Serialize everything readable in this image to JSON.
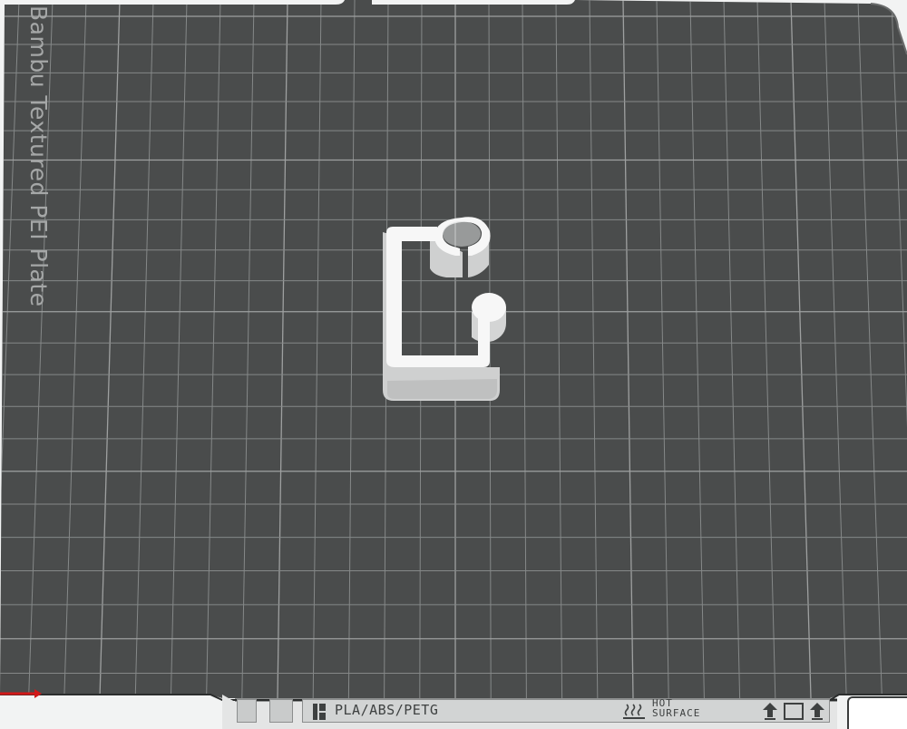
{
  "plate": {
    "name": "Bambu Textured PEI Plate",
    "material_label": "PLA/ABS/PETG",
    "hot_surface_label": "HOT\nSURFACE"
  },
  "colors": {
    "plate_surface": "#4a4c4c",
    "grid_line": "#8a8d8d",
    "grid_major": "#a0a2a2",
    "model": "#f5f5f5",
    "model_shadow": "#cfd0d0",
    "background": "#f2f3f3",
    "axis_x": "#d11818"
  },
  "icons": [
    "plate-type-icon",
    "heat-waves-icon",
    "lift-arrow-icon",
    "plate-outline-icon"
  ]
}
